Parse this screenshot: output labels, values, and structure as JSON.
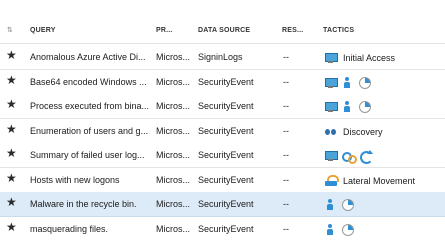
{
  "header": {
    "query": "QUERY",
    "provider": "PR...",
    "data_source": "DATA SOURCE",
    "results": "RES...",
    "tactics": "TACTICS"
  },
  "rows": [
    {
      "query": "Anomalous Azure Active Di...",
      "provider": "Micros...",
      "data_source": "SigninLogs",
      "results": "--",
      "tactic_icons": [
        "monitor-icon"
      ],
      "tactic_label": "Initial Access"
    },
    {
      "query": "Base64 encoded Windows ...",
      "provider": "Micros...",
      "data_source": "SecurityEvent",
      "results": "--",
      "tactic_icons": [
        "monitor-icon",
        "person-icon",
        "pie-icon"
      ],
      "tactic_label": ""
    },
    {
      "query": "Process executed from bina...",
      "provider": "Micros...",
      "data_source": "SecurityEvent",
      "results": "--",
      "tactic_icons": [
        "monitor-icon",
        "person-icon",
        "pie-icon"
      ],
      "tactic_label": ""
    },
    {
      "query": "Enumeration of users and g...",
      "provider": "Micros...",
      "data_source": "SecurityEvent",
      "results": "--",
      "tactic_icons": [
        "binoculars-icon"
      ],
      "tactic_label": "Discovery"
    },
    {
      "query": "Summary of failed user log...",
      "provider": "Micros...",
      "data_source": "SecurityEvent",
      "results": "--",
      "tactic_icons": [
        "monitor-icon",
        "gears-icon",
        "arrows-icon"
      ],
      "tactic_label": ""
    },
    {
      "query": "Hosts with new logons",
      "provider": "Micros...",
      "data_source": "SecurityEvent",
      "results": "--",
      "tactic_icons": [
        "lateral-movement-icon"
      ],
      "tactic_label": "Lateral Movement"
    },
    {
      "query": "Malware in the recycle bin.",
      "provider": "Micros...",
      "data_source": "SecurityEvent",
      "results": "--",
      "tactic_icons": [
        "person-icon",
        "pie-icon"
      ],
      "tactic_label": "",
      "selected": true
    },
    {
      "query": "masquerading files.",
      "provider": "Micros...",
      "data_source": "SecurityEvent",
      "results": "--",
      "tactic_icons": [
        "person-icon",
        "pie-icon"
      ],
      "tactic_label": ""
    }
  ],
  "colors": {
    "selected_row": "#dcebf7",
    "accent": "#2f8fd6"
  }
}
